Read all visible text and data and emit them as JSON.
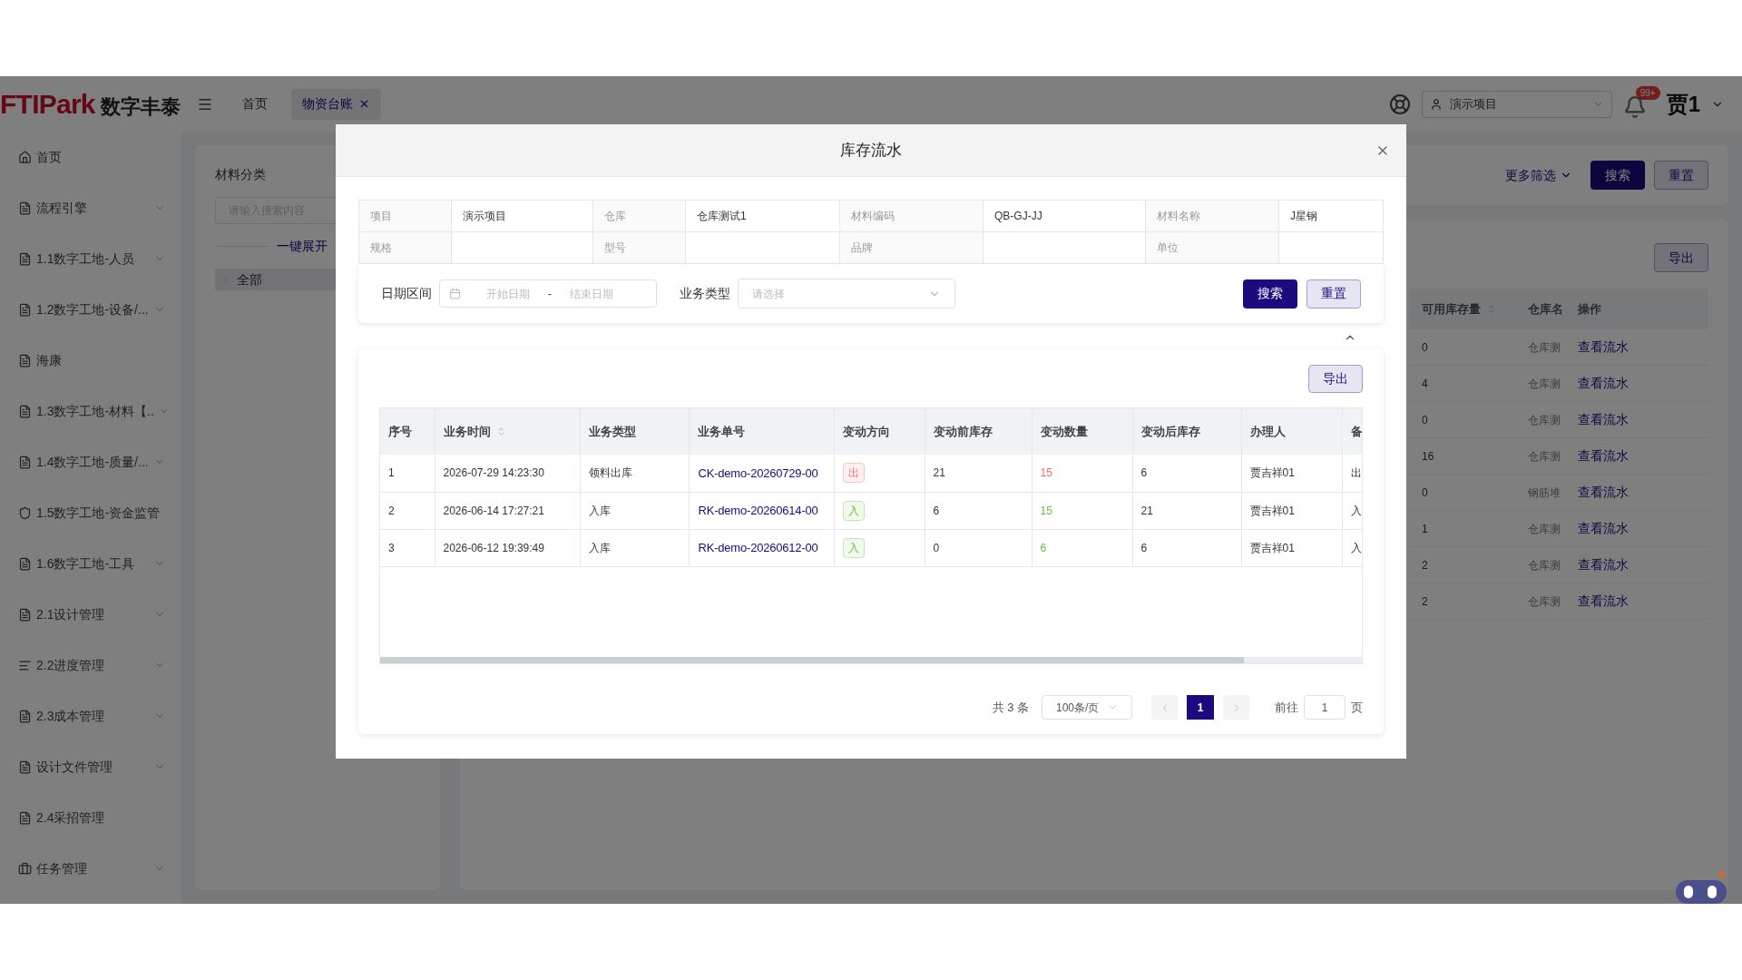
{
  "header": {
    "logo_mark": "FTIPark",
    "logo_text": "数字丰泰",
    "tabs": [
      {
        "label": "首页",
        "selected": false,
        "closable": false
      },
      {
        "label": "物资台账",
        "selected": true,
        "closable": true
      }
    ],
    "project_select": "演示项目",
    "notification_badge": "99+",
    "user": "贾1"
  },
  "sidebar": {
    "items": [
      {
        "label": "首页",
        "has_submenu": false
      },
      {
        "label": "流程引擎",
        "has_submenu": true
      },
      {
        "label": "1.1数字工地-人员",
        "has_submenu": true
      },
      {
        "label": "1.2数字工地-设备/...",
        "has_submenu": true
      },
      {
        "label": "海康",
        "has_submenu": false
      },
      {
        "label": "1.3数字工地-材料【..",
        "has_submenu": true
      },
      {
        "label": "1.4数字工地-质量/...",
        "has_submenu": true
      },
      {
        "label": "1.5数字工地-资金监管",
        "has_submenu": false
      },
      {
        "label": "1.6数字工地-工具",
        "has_submenu": true
      },
      {
        "label": "2.1设计管理",
        "has_submenu": true
      },
      {
        "label": "2.2进度管理",
        "has_submenu": true
      },
      {
        "label": "2.3成本管理",
        "has_submenu": true
      },
      {
        "label": "设计文件管理",
        "has_submenu": true
      },
      {
        "label": "2.4采招管理",
        "has_submenu": false
      },
      {
        "label": "任务管理",
        "has_submenu": true
      }
    ]
  },
  "category_panel": {
    "title": "材料分类",
    "search_placeholder": "请输入搜索内容",
    "expand_all": "一键展开",
    "tree": [
      {
        "label": "全部",
        "expanded": false
      }
    ]
  },
  "main_panel": {
    "more_filters": "更多筛选",
    "search_button": "搜索",
    "reset_button": "重置",
    "export_button": "导出",
    "columns": [
      "可用库存量",
      "仓库名",
      "操作"
    ],
    "rows": [
      {
        "stock": "0",
        "warehouse": "仓库测",
        "action": "查看流水"
      },
      {
        "stock": "4",
        "warehouse": "仓库测",
        "action": "查看流水"
      },
      {
        "stock": "0",
        "warehouse": "仓库测",
        "action": "查看流水"
      },
      {
        "stock": "16",
        "warehouse": "仓库测",
        "action": "查看流水"
      },
      {
        "stock": "0",
        "warehouse": "钢筋堆",
        "action": "查看流水"
      },
      {
        "stock": "1",
        "warehouse": "仓库测",
        "action": "查看流水"
      },
      {
        "stock": "2",
        "warehouse": "仓库测",
        "action": "查看流水"
      },
      {
        "stock": "2",
        "warehouse": "仓库测",
        "action": "查看流水"
      }
    ]
  },
  "dialog": {
    "title": "库存流水",
    "info": [
      [
        {
          "label": "项目",
          "value": "演示项目"
        },
        {
          "label": "仓库",
          "value": "仓库测试1"
        },
        {
          "label": "材料编码",
          "value": "QB-GJ-JJ"
        },
        {
          "label": "材料名称",
          "value": "J星钢"
        }
      ],
      [
        {
          "label": "规格"
        },
        {
          "label": "型号"
        },
        {
          "label": "品牌"
        },
        {
          "label": "单位"
        }
      ]
    ],
    "filters": {
      "date_label": "日期区间",
      "start_placeholder": "开始日期",
      "separator": "-",
      "end_placeholder": "结束日期",
      "type_label": "业务类型",
      "type_placeholder": "请选择",
      "search_button": "搜索",
      "reset_button": "重置"
    },
    "export_button": "导出",
    "columns": [
      "序号",
      "业务时间",
      "业务类型",
      "业务单号",
      "变动方向",
      "变动前库存",
      "变动数量",
      "变动后库存",
      "办理人",
      "备"
    ],
    "rows": [
      {
        "index": "1",
        "time": "2026-07-29 14:23:30",
        "type": "领料出库",
        "number": "CK-demo-20260729-00",
        "kind": "out",
        "direction": "出",
        "before": "21",
        "quantity": "15",
        "after": "6",
        "handler": "贾吉祥01",
        "column_10": "出"
      },
      {
        "index": "2",
        "time": "2026-06-14 17:27:21",
        "type": "入库",
        "number": "RK-demo-20260614-00",
        "kind": "in",
        "direction": "入",
        "before": "6",
        "quantity": "15",
        "after": "21",
        "handler": "贾吉祥01",
        "column_10": "入"
      },
      {
        "index": "3",
        "time": "2026-06-12 19:39:49",
        "type": "入库",
        "number": "RK-demo-20260612-00",
        "kind": "in",
        "direction": "入",
        "before": "0",
        "quantity": "6",
        "after": "6",
        "handler": "贾吉祥01",
        "column_10": "入"
      }
    ],
    "pagination": {
      "total": "共 3 条",
      "page_size": "100条/页",
      "pages": [
        {
          "label": "1",
          "selected": true
        }
      ],
      "goto_label": "前往",
      "goto_value": "1",
      "page_suffix": "页"
    }
  }
}
